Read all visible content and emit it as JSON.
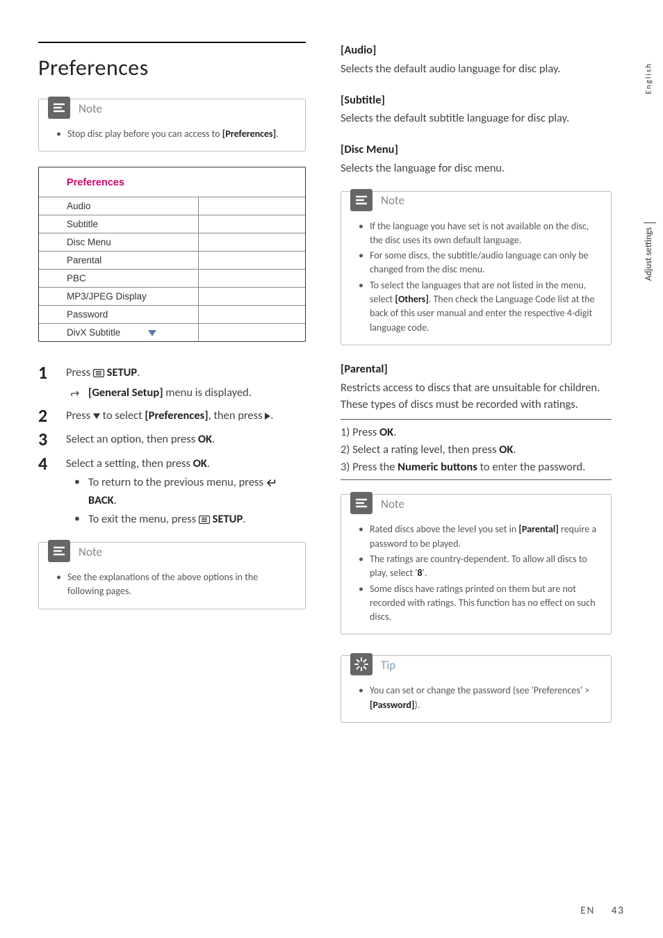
{
  "left": {
    "title": "Preferences",
    "note1_title": "Note",
    "note1_items": [
      "Stop disc play before you can access to <span class='bold'>[Preferences]</span>."
    ],
    "menu": {
      "title": "Preferences",
      "items": [
        "Audio",
        "Subtitle",
        "Disc Menu",
        "Parental",
        "PBC",
        "MP3/JPEG Display",
        "Password",
        "DivX Subtitle"
      ]
    },
    "steps": [
      {
        "n": "1",
        "body": "Press <span class='inline-icon'><svg width='16' height='12' viewBox='0 0 16 12'><rect x='0.5' y='0.5' width='15' height='11' rx='2' fill='none' stroke='#222' stroke-width='1.2'/><line x1='4' y1='3.5' x2='12' y2='3.5' stroke='#222' stroke-width='1.2'/><line x1='4' y1='6' x2='12' y2='6' stroke='#222' stroke-width='1.2'/><line x1='4' y1='8.5' x2='12' y2='8.5' stroke='#222' stroke-width='1.2'/></svg></span> <span class='bold'>SETUP</span>.",
        "subs": [
          {
            "cls": "arrow",
            "text": "<span class='bold'>[General Setup]</span> menu is displayed."
          }
        ]
      },
      {
        "n": "2",
        "body": "Press <span class='tri-down'></span> to select <span class='bold'>[Preferences]</span>, then press <span class='tri-right'></span>."
      },
      {
        "n": "3",
        "body": "Select an option, then press <span class='bold'>OK</span>."
      },
      {
        "n": "4",
        "body": "Select a setting, then press <span class='bold'>OK</span>.",
        "subs": [
          {
            "cls": "bullet",
            "text": "To return to the previous menu, press <span class='inline-icon'><svg width='18' height='12' viewBox='0 0 18 12'><path d='M6 2 L2 6 L6 10 M2 6 H12 A4 4 0 0 0 12 2' fill='none' stroke='#222' stroke-width='1.6' stroke-linecap='round'/></svg></span> <span class='bold'>BACK</span>."
          },
          {
            "cls": "bullet",
            "text": "To exit the menu, press <span class='inline-icon'><svg width='16' height='12' viewBox='0 0 16 12'><rect x='0.5' y='0.5' width='15' height='11' rx='2' fill='none' stroke='#222' stroke-width='1.2'/><line x1='4' y1='3.5' x2='12' y2='3.5' stroke='#222' stroke-width='1.2'/><line x1='4' y1='6' x2='12' y2='6' stroke='#222' stroke-width='1.2'/><line x1='4' y1='8.5' x2='12' y2='8.5' stroke='#222' stroke-width='1.2'/></svg></span> <span class='bold'>SETUP</span>."
          }
        ]
      }
    ],
    "note2_title": "Note",
    "note2_items": [
      "See the explanations of the above options in the following pages."
    ]
  },
  "right": {
    "sections": [
      {
        "title": "[Audio]",
        "body": "Selects the default audio language for disc play."
      },
      {
        "title": "[Subtitle]",
        "body": "Selects the default subtitle language for disc play."
      },
      {
        "title": "[Disc Menu]",
        "body": "Selects the language for disc menu."
      }
    ],
    "note3_title": "Note",
    "note3_items": [
      "If the language you have set is not available on the disc, the disc uses its own default language.",
      "For some discs, the subtitle/audio language can only be changed from the disc menu.",
      "To select the languages that are not listed in the menu, select <span class='bold'>[Others]</span>. Then check the Language Code list at the back of this user manual and enter the respective 4-digit language code."
    ],
    "parental": {
      "title": "[Parental]",
      "body": "Restricts access to discs that are unsuitable for children. These types of discs must be recorded with ratings.",
      "steps": [
        "1) Press <span class='bold'>OK</span>.",
        "2) Select a rating level, then press <span class='bold'>OK</span>.",
        "3) Press the <span class='bold'>Numeric buttons</span> to enter the password."
      ]
    },
    "note4_title": "Note",
    "note4_items": [
      "Rated discs above the level you set in <span class='bold'>[Parental]</span> require a password to be played.",
      "The ratings are country-dependent. To allow all discs to play, select '<span class='bold'>8</span>'.",
      "Some discs have ratings printed on them but are not recorded with ratings. This function has no effect on such discs."
    ],
    "tip_title": "Tip",
    "tip_items": [
      "You can set or change the password (see 'Preferences' > <span class='bold'>[Password]</span>)."
    ]
  },
  "side_tab": "English",
  "side_tab2": "Adjust settings",
  "footer_lang": "EN",
  "footer_page": "43"
}
